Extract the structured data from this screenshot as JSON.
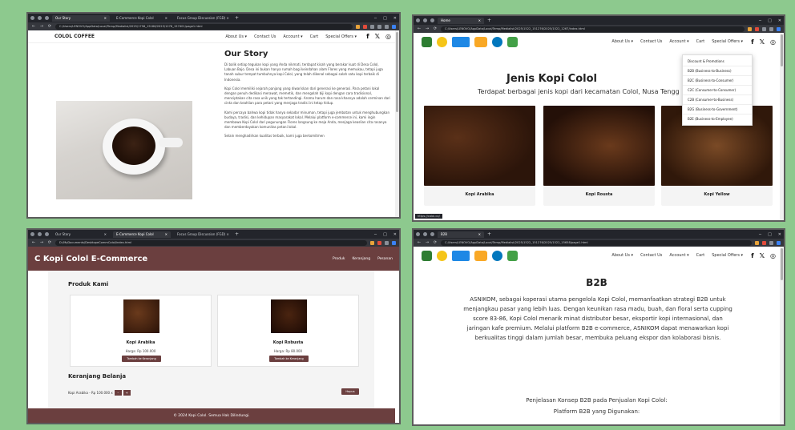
{
  "colors": {
    "bg": "#8dc98e",
    "brand_brown": "#6b3f3f",
    "dark_chrome": "#23252b"
  },
  "w1": {
    "tabs": [
      {
        "title": "Our Story"
      },
      {
        "title": "E-Commerce Kopi Colol"
      },
      {
        "title": "Focus Group Discussion (FGD) ×"
      }
    ],
    "url": "C:/Users/LENOVO/AppData/Local/Temp/Medialist/2025/1756_15186/2025/1276_157401/page1.html",
    "brand": "COLOL COFFEE",
    "nav": [
      "About Us ▾",
      "Contact Us",
      "Account ▾",
      "Cart",
      "Special Offers ▾"
    ],
    "heading": "Our Story",
    "paragraphs": [
      "Di balik setiap tegukan kopi yang Anda nikmati, terdapat kisah yang berakar kuat di Desa Colol, Labuan Bajo. Desa ini bukan hanya rumah bagi keindahan alam Flores yang memukau, tetapi juga tanah subur tempat tumbuhnya kopi Colol, yang telah dikenal sebagai salah satu kopi terbaik di Indonesia.",
      "Kopi Colol memiliki sejarah panjang yang diwariskan dari generasi ke generasi. Para petani lokal dengan penuh dedikasi merawat, memetik, dan mengolah biji kopi dengan cara tradisional, menciptakan cita rasa unik yang tak tertandingi. Aroma harum dan rasa khasnya adalah cerminan dari cinta dan keahlian para petani yang menjaga tradisi ini tetap hidup.",
      "Kami percaya bahwa kopi tidak hanya sekadar minuman, tetapi juga jembatan untuk menghubungkan budaya, tradisi, dan kehidupan masyarakat lokal. Melalui platform e-commerce ini, kami ingin membawa Kopi Colol dari pegunungan Flores langsung ke meja Anda, menjaga keaslian cita rasanya dan memberdayakan komunitas petani lokal.",
      "Selain menghadirkan kualitas terbaik, kami juga berkomitmen"
    ]
  },
  "w2": {
    "tabs": [
      {
        "title": "Home"
      }
    ],
    "url": "C:/Users/LENOVO/AppData/Local/Temp/Medialist/2025/1522_151276/2025/1522_1267/index.html",
    "nav": [
      "About Us ▾",
      "Contact Us",
      "Account ▾",
      "Cart",
      "Special Offers ▾"
    ],
    "dropdown": [
      "Discount & Promotions",
      "B2B (Business-to-Business)",
      "B2C (Business-to-Consumer)",
      "C2C (Consumer-to-Consumer)",
      "C2B (Consumer-to-Business)",
      "B2G (Business-to-Government)",
      "B2E (Business-to-Employee)"
    ],
    "title": "Jenis Kopi Colol",
    "subtitle": "Terdapat berbagai jenis kopi dari kecamatan Colol, Nusa Tengg",
    "products": [
      "Kopi Arabika",
      "Kopi Rousta",
      "Kopi Yellow"
    ],
    "status_url": "https://colol.co/"
  },
  "w3": {
    "tabs": [
      {
        "title": "Our Story"
      },
      {
        "title": "E-Commerce Kopi Colol"
      },
      {
        "title": "Focus Group Discussion (FGD) ×"
      }
    ],
    "url": "D:/MyDocuments/DesktopeCommColol/index.html",
    "header_title": "C Kopi Colol E-Commerce",
    "nav": [
      "Produk",
      "Keranjang",
      "Pesanan"
    ],
    "section_products": "Produk Kami",
    "products": [
      {
        "name": "Kopi Arabika",
        "price": "Harga: Rp 100.000",
        "button": "Tambah ke Keranjang"
      },
      {
        "name": "Kopi Robusta",
        "price": "Harga: Rp 80.000",
        "button": "Tambah ke Keranjang"
      }
    ],
    "section_cart": "Keranjang Belanja",
    "cart_line": "Kopi Arabika - Rp 100.000 x",
    "cart_minus": "-",
    "cart_plus": "+",
    "cart_button": "Hapus",
    "footer": "© 2024 Kopi Colol. Semua Hak Dilindungi."
  },
  "w4": {
    "tabs": [
      {
        "title": "B2B"
      }
    ],
    "url": "C:/Users/LENOVO/AppData/Local/Temp/Medialist/2025/1522_151276/2025/1522_15658/page1.html",
    "nav": [
      "About Us ▾",
      "Contact Us",
      "Account ▾",
      "Cart",
      "Special Offers ▾"
    ],
    "title": "B2B",
    "body": "ASNIKOM, sebagai koperasi utama pengelola Kopi Colol, memanfaatkan strategi B2B untuk menjangkau pasar yang lebih luas. Dengan keunikan rasa madu, buah, dan floral serta cupping score 83-86, Kopi Colol menarik minat distributor besar, eksportir kopi internasional, dan jaringan kafe premium. Melalui platform B2B e-commerce, ASNIKOM dapat menawarkan kopi berkualitas tinggi dalam jumlah besar, membuka peluang ekspor dan kolaborasi bisnis.",
    "line1": "Penjelasan Konsep B2B pada Penjualan Kopi Colol:",
    "line2": "Platform B2B yang Digunakan:"
  },
  "icons": {
    "facebook": "f",
    "twitter": "𝕏",
    "instagram": "◎",
    "back": "←",
    "forward": "→",
    "reload": "⟳",
    "home": "⌂",
    "close": "✕",
    "minimize": "─",
    "maximize": "□"
  }
}
